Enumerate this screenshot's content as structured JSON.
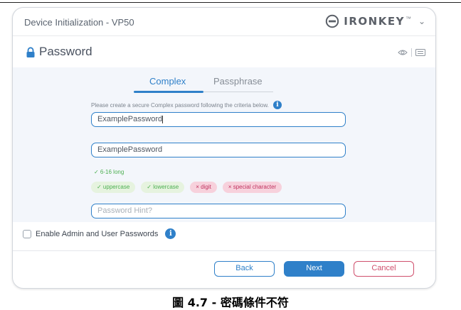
{
  "app": {
    "title": "Device Initialization - VP50"
  },
  "brand": {
    "name": "IRONKEY",
    "trademark": "™"
  },
  "section": {
    "title": "Password"
  },
  "tabs": [
    {
      "label": "Complex",
      "active": true
    },
    {
      "label": "Passphrase",
      "active": false
    }
  ],
  "form": {
    "criteria_text": "Please create a secure Complex password following the criteria below.",
    "password_value": "ExamplePassword",
    "confirm_value": "ExamplePassword",
    "hint_placeholder": "Password Hint?"
  },
  "requirements": {
    "length": {
      "label": "✓ 6-16 long",
      "met": true
    },
    "chips": [
      {
        "label": "✓ uppercase",
        "met": true
      },
      {
        "label": "✓ lowercase",
        "met": true
      },
      {
        "label": "× digit",
        "met": false
      },
      {
        "label": "× special character",
        "met": false
      }
    ]
  },
  "admin_option": {
    "label": "Enable Admin and User Passwords",
    "checked": false
  },
  "buttons": {
    "back": "Back",
    "next": "Next",
    "cancel": "Cancel"
  },
  "caption": "圖 4.7 - 密碼條件不符",
  "icons": [
    "ironkey-logo-icon",
    "chevron-down-icon",
    "lock-icon",
    "eye-icon",
    "keyboard-icon",
    "info-icon"
  ],
  "colors": {
    "accent": "#2f80c9",
    "ok": "#4caf50",
    "error": "#c0325f",
    "cancel": "#d0506d"
  }
}
